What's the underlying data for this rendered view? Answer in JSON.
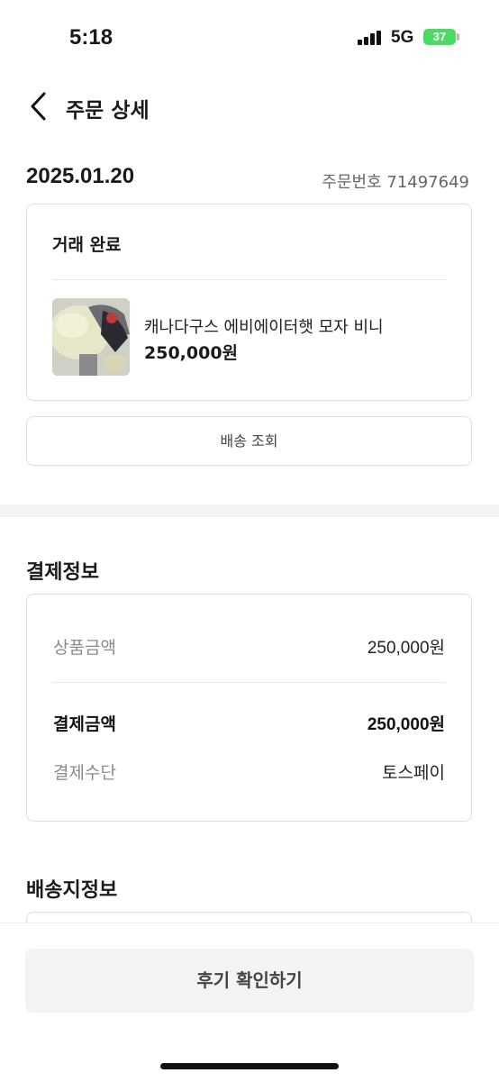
{
  "status_bar": {
    "time": "5:18",
    "network": "5G",
    "battery": "37"
  },
  "header": {
    "back_icon": "chevron-left-icon",
    "title": "주문 상세"
  },
  "order": {
    "date": "2025.01.20",
    "number_label": "주문번호 71497649",
    "status": "거래 완료",
    "product": {
      "name": "캐나다구스 에비에이터햇 모자 비니",
      "price": "250,000원"
    },
    "shipping_button": "배송 조회"
  },
  "payment": {
    "title": "결제정보",
    "rows": [
      {
        "label": "상품금액",
        "value": "250,000원"
      },
      {
        "label": "결제금액",
        "value": "250,000원"
      },
      {
        "label": "결제수단",
        "value": "토스페이"
      }
    ]
  },
  "delivery": {
    "title": "배송지정보"
  },
  "footer": {
    "review_button": "후기 확인하기"
  },
  "colors": {
    "battery": "#4cd964",
    "text": "#1a1a1a",
    "muted": "#8a8a8a",
    "border": "#dedede"
  }
}
